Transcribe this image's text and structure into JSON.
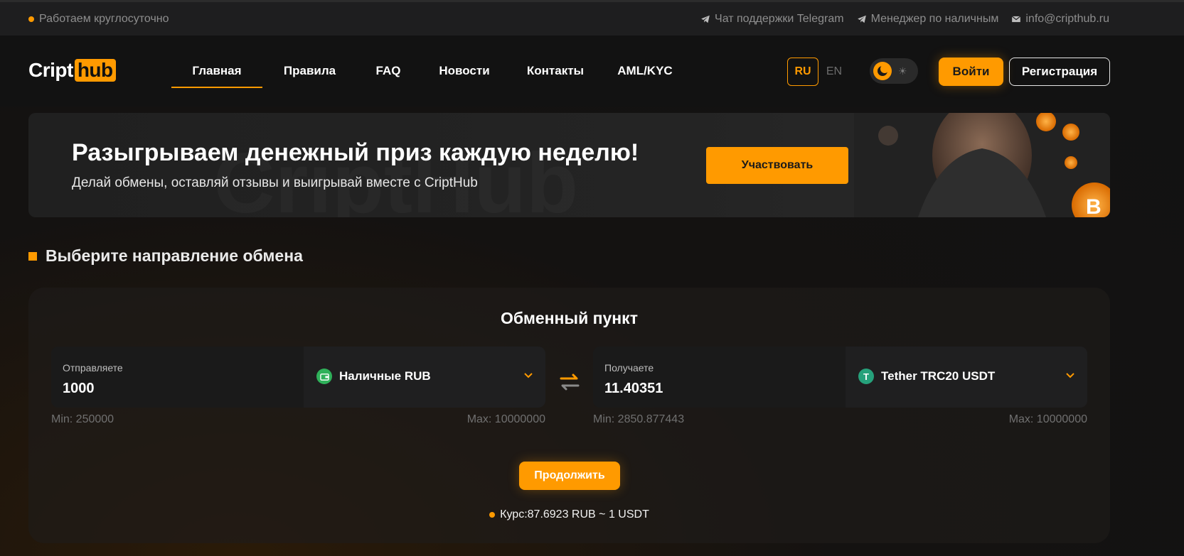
{
  "topbar": {
    "status": "Работаем круглосуточно",
    "links": [
      {
        "label": "Чат поддержки Telegram",
        "icon": "telegram-icon"
      },
      {
        "label": "Менеджер по наличным",
        "icon": "telegram-icon"
      },
      {
        "label": "info@cripthub.ru",
        "icon": "mail-icon"
      }
    ]
  },
  "header": {
    "logo_part1": "Cript",
    "logo_part2": "hub",
    "nav": [
      {
        "label": "Главная",
        "active": true
      },
      {
        "label": "Правила"
      },
      {
        "label": "FAQ"
      },
      {
        "label": "Новости"
      },
      {
        "label": "Контакты"
      },
      {
        "label": "AML/KYC"
      }
    ],
    "lang_ru": "RU",
    "lang_en": "EN",
    "login": "Войти",
    "register": "Регистрация"
  },
  "banner": {
    "title": "Разыгрываем денежный приз каждую неделю!",
    "subtitle": "Делай обмены, оставляй отзывы и выигрывай вместе с CriptHub",
    "button": "Участвовать"
  },
  "section": {
    "title": "Выберите направление обмена"
  },
  "exchange": {
    "title": "Обменный пункт",
    "send": {
      "label": "Отправляете",
      "amount": "1000",
      "currency": "Наличные RUB",
      "min": "Min: 250000",
      "max": "Max: 10000000"
    },
    "receive": {
      "label": "Получаете",
      "amount": "11.40351",
      "currency": "Tether TRC20 USDT",
      "min": "Min: 2850.877443",
      "max": "Max: 10000000"
    },
    "continue": "Продолжить",
    "rate": "Курс:87.6923 RUB ~ 1 USDT"
  },
  "colors": {
    "accent": "#ff9a00",
    "background": "#121212",
    "rub_icon": "#2fb15a",
    "usdt_icon": "#26a17b"
  }
}
